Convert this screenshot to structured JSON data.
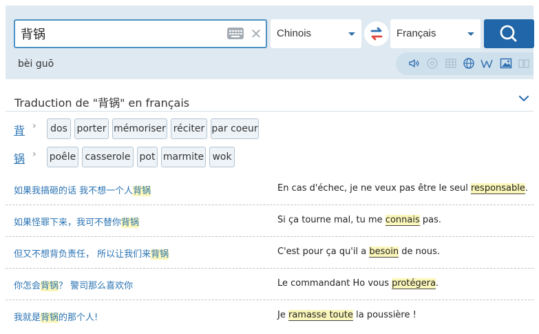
{
  "search": {
    "query": "背锅",
    "pinyin": "bèi guō",
    "source_lang": "Chinois",
    "target_lang": "Français"
  },
  "colors": {
    "panel": "#dfe9f1",
    "accent": "#2066a8",
    "link": "#2a73b3",
    "highlight": "#fbf6b9"
  },
  "tools": [
    "speaker-icon",
    "audio-disc-icon",
    "table-icon",
    "globe-icon",
    "wikipedia-icon",
    "image-icon",
    "book-icon"
  ],
  "translation": {
    "title": "Traduction de \"背锅\" en français"
  },
  "words": [
    {
      "head": "背",
      "translations": [
        "dos",
        "porter",
        "mémoriser",
        "réciter",
        "par coeur"
      ]
    },
    {
      "head": "锅",
      "translations": [
        "poêle",
        "casserole",
        "pot",
        "marmite",
        "wok"
      ]
    }
  ],
  "examples": [
    {
      "src_pre": "如果我搞砸的话 我不想一个人",
      "src_hl": "背锅",
      "src_post": "",
      "tgt_pre": "En cas d'échec, je ne veux pas être le seul ",
      "tgt_hl": "responsable",
      "tgt_post": "."
    },
    {
      "src_pre": "如果怪罪下来，我可不替你",
      "src_hl": "背锅",
      "src_post": "",
      "tgt_pre": "Si ça tourne mal, tu me ",
      "tgt_hl": "connais",
      "tgt_post": " pas."
    },
    {
      "src_pre": "但又不想背负责任，  所以让我们来",
      "src_hl": "背锅",
      "src_post": "",
      "tgt_pre": "C'est pour ça qu'il a ",
      "tgt_hl": "besoin",
      "tgt_post": " de nous."
    },
    {
      "src_pre": "你怎会",
      "src_hl": "背锅",
      "src_post": "？  警司那么喜欢你",
      "tgt_pre": "Le commandant Ho vous ",
      "tgt_hl": "protégera",
      "tgt_post": "."
    },
    {
      "src_pre": "我就是",
      "src_hl": "背锅",
      "src_post": "的那个人!",
      "tgt_pre": "Je ",
      "tgt_hl": "ramasse toute",
      "tgt_post": " la poussière !"
    }
  ]
}
